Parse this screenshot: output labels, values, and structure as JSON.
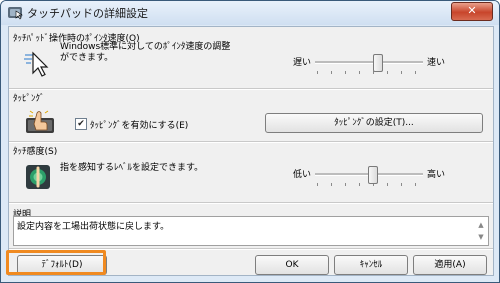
{
  "window": {
    "title": "タッチパッドの詳細設定",
    "close_label": "✕"
  },
  "pointer_speed": {
    "title": "ﾀｯﾁﾊﾟｯﾄﾞ操作時のﾎﾟｲﾝﾀ速度(O)",
    "desc_line1": "Windows標準に対してのﾎﾟｲﾝﾀ速度の調整",
    "desc_line2": "ができます。",
    "min_label": "遅い",
    "max_label": "速い",
    "level": 0.5
  },
  "tapping": {
    "title": "ﾀｯﾋﾟﾝｸﾞ",
    "checkbox_label": "ﾀｯﾋﾟﾝｸﾞを有効にする(E)",
    "checked": true,
    "settings_button": "ﾀｯﾋﾟﾝｸﾞの設定(T)..."
  },
  "sensitivity": {
    "title": "ﾀｯﾁ感度(S)",
    "desc": "指を感知するﾚﾍﾞﾙを設定できます。",
    "min_label": "低い",
    "max_label": "高い",
    "level": 0.45
  },
  "explanation": {
    "title": "説明",
    "text": "設定内容を工場出荷状態に戻します。"
  },
  "buttons": {
    "default": "ﾃﾞﾌｫﾙﾄ(D)",
    "ok": "OK",
    "cancel": "ｷｬﾝｾﾙ",
    "apply": "適用(A)"
  },
  "colors": {
    "highlight": "#f08a21",
    "close_button": "#c8452b"
  }
}
